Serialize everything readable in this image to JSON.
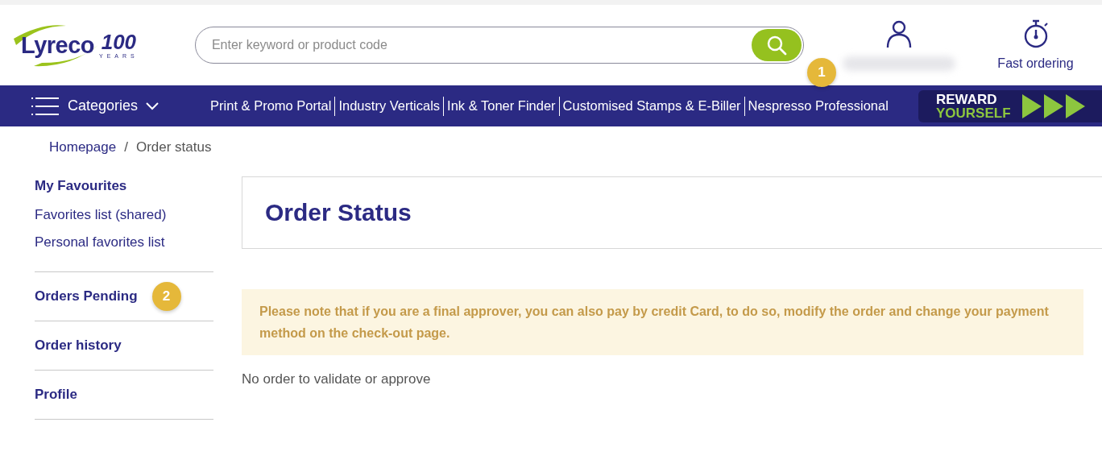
{
  "logo": {
    "name": "Lyreco",
    "anniversary": "100",
    "anniversary_caption": "YEARS"
  },
  "search": {
    "placeholder": "Enter keyword or product code"
  },
  "header_actions": [
    {
      "kind": "account",
      "redacted": true,
      "badge": "1"
    },
    {
      "kind": "fast",
      "label": "Fast ordering",
      "redacted": false
    }
  ],
  "nav": {
    "menu_label": "Categories",
    "links": [
      "Print & Promo Portal",
      "Industry Verticals",
      "Ink & Toner Finder",
      "Customised Stamps & E-Biller",
      "Nespresso Professional"
    ],
    "promo": {
      "line_1": "REWARD",
      "line_2": "YOURSELF"
    }
  },
  "breadcrumb": {
    "items": [
      "Homepage",
      "Order status"
    ],
    "separator": "/"
  },
  "sidebar": {
    "sections": [
      {
        "title": "My Favourites",
        "links": [
          "Favorites list (shared)",
          "Personal favorites list"
        ]
      },
      {
        "title": "Orders Pending",
        "badge": "2"
      },
      {
        "title": "Order history"
      },
      {
        "title": "Profile"
      }
    ]
  },
  "page_title": "Order Status",
  "notice": "Please note that if you are a final approver, you can also pay by credit Card, to do so, modify the order and change your payment method on the check-out page.",
  "empty_message": "No order to validate or approve"
}
